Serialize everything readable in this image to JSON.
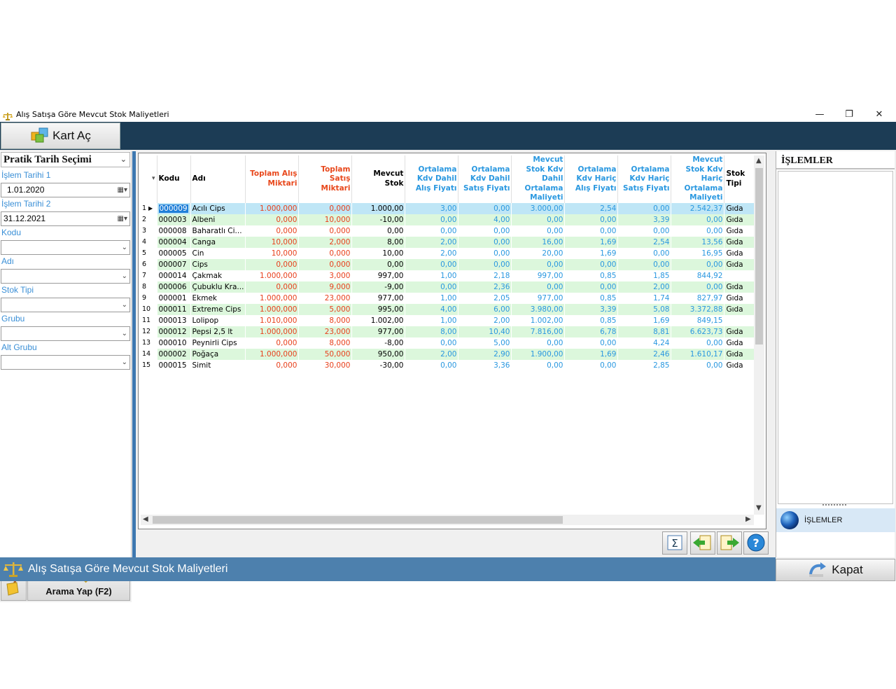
{
  "window": {
    "title": "Alış Satışa Göre Mevcut Stok Maliyetleri",
    "minimize": "—",
    "restore": "❐",
    "close": "✕"
  },
  "toolbar": {
    "kart_ac_label": "Kart Aç"
  },
  "filters": {
    "pratik_label": "Pratik Tarih Seçimi",
    "date1_label": "İşlem Tarihi 1",
    "date1_value": "1.01.2020",
    "date2_label": "İşlem Tarihi 2",
    "date2_value": "31.12.2021",
    "kodu_label": "Kodu",
    "adi_label": "Adı",
    "stoktipi_label": "Stok Tipi",
    "grubu_label": "Grubu",
    "altgrubu_label": "Alt Grubu",
    "search_label": "Arama Yap (F2)"
  },
  "grid": {
    "headers": {
      "kodu": "Kodu",
      "adi": "Adı",
      "toplam_alis": "Toplam Alış Miktari",
      "toplam_satis": "Toplam Satış Miktari",
      "mevcut_stok": "Mevcut Stok",
      "ort_kdv_dahil_alis": "Ortalama Kdv Dahil Alış Fiyatı",
      "ort_kdv_dahil_satis": "Ortalama Kdv Dahil Satış Fiyatı",
      "mevcut_dahil_maliyet": "Mevcut Stok Kdv Dahil Ortalama Maliyeti",
      "ort_kdv_haric_alis": "Ortalama Kdv Hariç Alış Fiyatı",
      "ort_kdv_haric_satis": "Ortalama Kdv Hariç Satış Fiyatı",
      "mevcut_haric_maliyet": "Mevcut Stok Kdv Hariç Ortalama Maliyeti",
      "stok_tipi": "Stok Tipi"
    },
    "rows": [
      [
        "1",
        "000009",
        "Acılı Cips",
        "1.000,000",
        "0,000",
        "1.000,00",
        "3,00",
        "0,00",
        "3.000,00",
        "2,54",
        "0,00",
        "2.542,37",
        "Gıda"
      ],
      [
        "2",
        "000003",
        "Albeni",
        "0,000",
        "10,000",
        "-10,00",
        "0,00",
        "4,00",
        "0,00",
        "0,00",
        "3,39",
        "0,00",
        "Gıda"
      ],
      [
        "3",
        "000008",
        "Baharatlı Ci...",
        "0,000",
        "0,000",
        "0,00",
        "0,00",
        "0,00",
        "0,00",
        "0,00",
        "0,00",
        "0,00",
        "Gıda"
      ],
      [
        "4",
        "000004",
        "Canga",
        "10,000",
        "2,000",
        "8,00",
        "2,00",
        "0,00",
        "16,00",
        "1,69",
        "2,54",
        "13,56",
        "Gıda"
      ],
      [
        "5",
        "000005",
        "Cin",
        "10,000",
        "0,000",
        "10,00",
        "2,00",
        "0,00",
        "20,00",
        "1,69",
        "0,00",
        "16,95",
        "Gıda"
      ],
      [
        "6",
        "000007",
        "Cips",
        "0,000",
        "0,000",
        "0,00",
        "0,00",
        "0,00",
        "0,00",
        "0,00",
        "0,00",
        "0,00",
        "Gıda"
      ],
      [
        "7",
        "000014",
        "Çakmak",
        "1.000,000",
        "3,000",
        "997,00",
        "1,00",
        "2,18",
        "997,00",
        "0,85",
        "1,85",
        "844,92",
        ""
      ],
      [
        "8",
        "000006",
        "Çubuklu Kra...",
        "0,000",
        "9,000",
        "-9,00",
        "0,00",
        "2,36",
        "0,00",
        "0,00",
        "2,00",
        "0,00",
        "Gıda"
      ],
      [
        "9",
        "000001",
        "Ekmek",
        "1.000,000",
        "23,000",
        "977,00",
        "1,00",
        "2,05",
        "977,00",
        "0,85",
        "1,74",
        "827,97",
        "Gıda"
      ],
      [
        "10",
        "000011",
        "Extreme Cips",
        "1.000,000",
        "5,000",
        "995,00",
        "4,00",
        "6,00",
        "3.980,00",
        "3,39",
        "5,08",
        "3.372,88",
        "Gıda"
      ],
      [
        "11",
        "000013",
        "Lolipop",
        "1.010,000",
        "8,000",
        "1.002,00",
        "1,00",
        "2,00",
        "1.002,00",
        "0,85",
        "1,69",
        "849,15",
        ""
      ],
      [
        "12",
        "000012",
        "Pepsi 2,5 lt",
        "1.000,000",
        "23,000",
        "977,00",
        "8,00",
        "10,40",
        "7.816,00",
        "6,78",
        "8,81",
        "6.623,73",
        "Gıda"
      ],
      [
        "13",
        "000010",
        "Peynirli Cips",
        "0,000",
        "8,000",
        "-8,00",
        "0,00",
        "5,00",
        "0,00",
        "0,00",
        "4,24",
        "0,00",
        "Gıda"
      ],
      [
        "14",
        "000002",
        "Poğaça",
        "1.000,000",
        "50,000",
        "950,00",
        "2,00",
        "2,90",
        "1.900,00",
        "1,69",
        "2,46",
        "1.610,17",
        "Gıda"
      ],
      [
        "15",
        "000015",
        "Simit",
        "0,000",
        "30,000",
        "-30,00",
        "0,00",
        "3,36",
        "0,00",
        "0,00",
        "2,85",
        "0,00",
        "Gıda"
      ]
    ]
  },
  "right_panel": {
    "header": "İŞLEMLER",
    "item_label": "İŞLEMLER"
  },
  "statusbar": {
    "text": "Alış Satışa Göre Mevcut Stok Maliyetleri"
  },
  "kapat_label": "Kapat",
  "icons": {
    "scroll_up": "▲",
    "scroll_down": "▼",
    "scroll_left": "◀",
    "scroll_right": "▶",
    "sigma": "Σ",
    "help": "?",
    "row_pointer": "▶"
  },
  "colors": {
    "toolbar_bg": "#1c3c55",
    "statusbar_bg": "#4d80ad",
    "header_red": "#e8481c",
    "header_blue": "#2a98e0",
    "row_even_bg": "#dcf7dc",
    "row_selected_bg": "#bfe6f6",
    "label_blue": "#3a8fd6"
  }
}
